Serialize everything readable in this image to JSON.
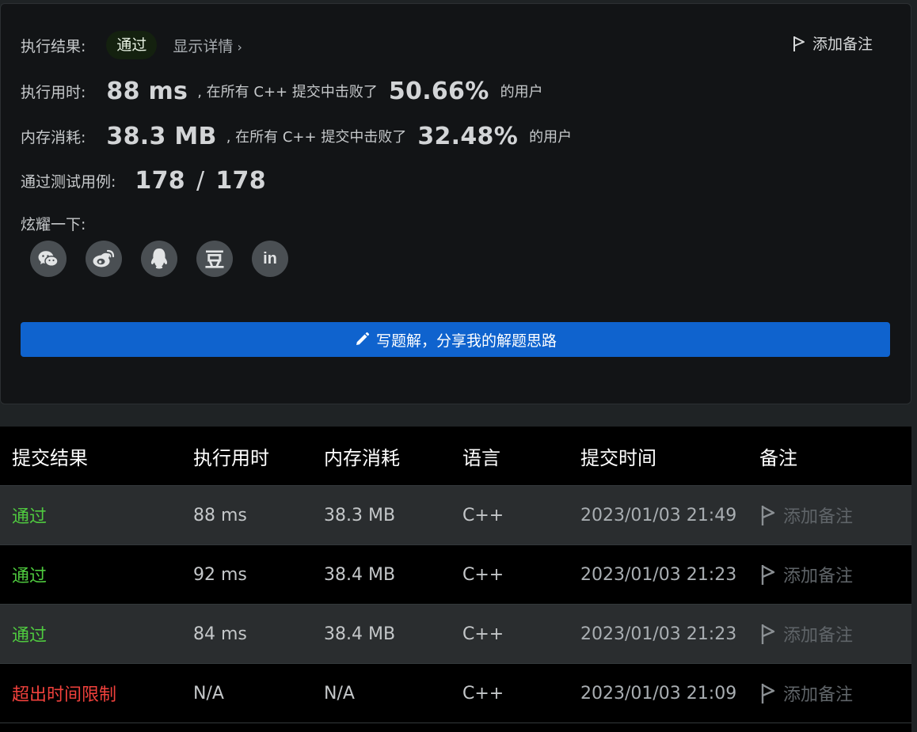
{
  "result": {
    "label": "执行结果:",
    "status": "通过",
    "details_link": "显示详情",
    "add_note": "添加备注"
  },
  "runtime": {
    "label": "执行用时:",
    "value": "88 ms",
    "middle": ", 在所有 C++ 提交中击败了",
    "percent": "50.66%",
    "suffix": "的用户"
  },
  "memory": {
    "label": "内存消耗:",
    "value": "38.3 MB",
    "middle": ", 在所有 C++ 提交中击败了",
    "percent": "32.48%",
    "suffix": "的用户"
  },
  "testcases": {
    "label": "通过测试用例:",
    "passed": "178",
    "separator": "/",
    "total": "178"
  },
  "share": {
    "label": "炫耀一下:",
    "icons": [
      "wechat-icon",
      "weibo-icon",
      "qq-icon",
      "douban-icon",
      "linkedin-icon"
    ],
    "douban_glyph": "豆",
    "linkedin_glyph": "in"
  },
  "solution_button": "写题解，分享我的解题思路",
  "table": {
    "headers": [
      "提交结果",
      "执行用时",
      "内存消耗",
      "语言",
      "提交时间",
      "备注"
    ],
    "rows": [
      {
        "result": "通过",
        "status": "ok",
        "time": "88 ms",
        "memory": "38.3 MB",
        "lang": "C++",
        "submitted": "2023/01/03 21:49",
        "note": "添加备注"
      },
      {
        "result": "通过",
        "status": "ok",
        "time": "92 ms",
        "memory": "38.4 MB",
        "lang": "C++",
        "submitted": "2023/01/03 21:23",
        "note": "添加备注"
      },
      {
        "result": "通过",
        "status": "ok",
        "time": "84 ms",
        "memory": "38.4 MB",
        "lang": "C++",
        "submitted": "2023/01/03 21:23",
        "note": "添加备注"
      },
      {
        "result": "超出时间限制",
        "status": "bad",
        "time": "N/A",
        "memory": "N/A",
        "lang": "C++",
        "submitted": "2023/01/03 21:09",
        "note": "添加备注"
      }
    ]
  },
  "colors": {
    "accepted": "#4fca3f",
    "error": "#f0413c",
    "primary_button": "#0f63ce"
  }
}
